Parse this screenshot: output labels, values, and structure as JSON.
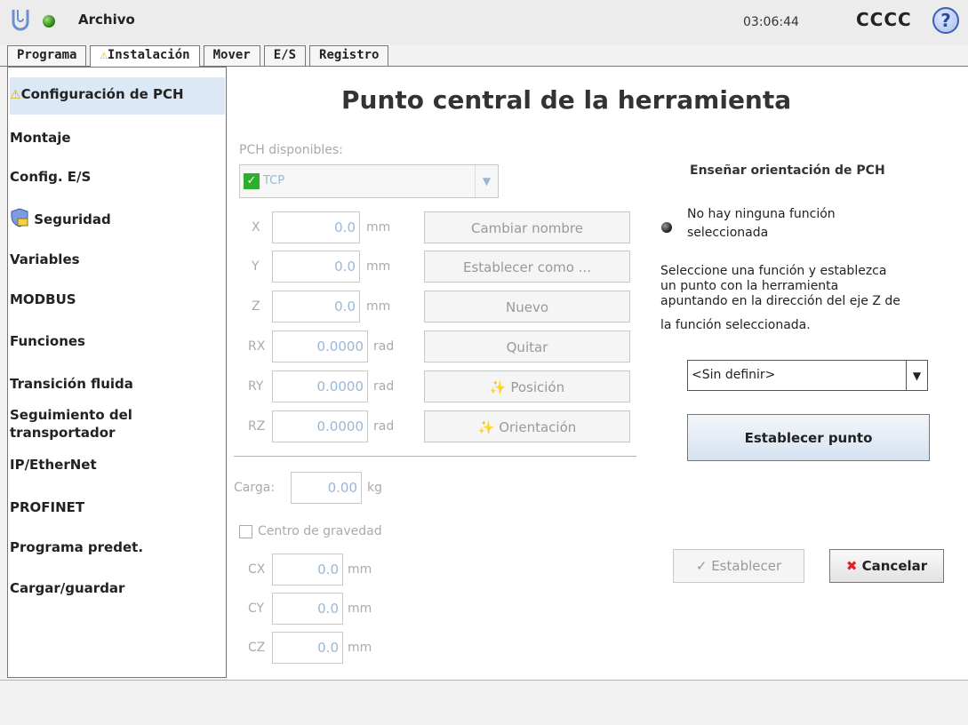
{
  "header": {
    "file_menu": "Archivo",
    "time": "03:06:44",
    "robot_name": "CCCC",
    "help_symbol": "?"
  },
  "tabs": [
    {
      "label": "Programa",
      "warning": false
    },
    {
      "label": "Instalación",
      "warning": true
    },
    {
      "label": "Mover",
      "warning": false
    },
    {
      "label": "E/S",
      "warning": false
    },
    {
      "label": "Registro",
      "warning": false
    }
  ],
  "sidebar": {
    "items": [
      {
        "label": "Configuración de PCH",
        "warning": true,
        "active": true
      },
      {
        "label": "Montaje"
      },
      {
        "label": "Config. E/S"
      },
      {
        "label": "Seguridad",
        "icon": "shield-icon"
      },
      {
        "label": "Variables"
      },
      {
        "label": "MODBUS"
      },
      {
        "label": "Funciones"
      },
      {
        "label": "Transición fluida"
      },
      {
        "label": "Seguimiento del transportador"
      },
      {
        "label": "IP/EtherNet"
      },
      {
        "label": "PROFINET"
      },
      {
        "label": "Programa predet."
      },
      {
        "label": "Cargar/guardar"
      }
    ]
  },
  "main": {
    "title": "Punto central de la herramienta",
    "available_label": "PCH disponibles:",
    "selected_tcp": "TCP",
    "fields": [
      {
        "label": "X",
        "value": "0.0",
        "unit": "mm"
      },
      {
        "label": "Y",
        "value": "0.0",
        "unit": "mm"
      },
      {
        "label": "Z",
        "value": "0.0",
        "unit": "mm"
      },
      {
        "label": "RX",
        "value": "0.0000",
        "unit": "rad"
      },
      {
        "label": "RY",
        "value": "0.0000",
        "unit": "rad"
      },
      {
        "label": "RZ",
        "value": "0.0000",
        "unit": "rad"
      }
    ],
    "buttons": {
      "rename": "Cambiar nombre",
      "set_as": "Establecer como ...",
      "new": "Nuevo",
      "remove": "Quitar",
      "position": "Posición",
      "orientation": "Orientación"
    },
    "payload": {
      "label": "Carga:",
      "value": "0.00",
      "unit": "kg"
    },
    "cog": {
      "checkbox_label": "Centro de gravedad",
      "fields": [
        {
          "label": "CX",
          "value": "0.0",
          "unit": "mm"
        },
        {
          "label": "CY",
          "value": "0.0",
          "unit": "mm"
        },
        {
          "label": "CZ",
          "value": "0.0",
          "unit": "mm"
        }
      ]
    }
  },
  "right_panel": {
    "title": "Enseñar orientación de PCH",
    "status_line1": "No hay ninguna función",
    "status_line2": "seleccionada",
    "instruction_lines": [
      "Seleccione una función y establezca",
      "un punto con la herramienta",
      "apuntando en la dirección del eje Z de",
      "la función seleccionada."
    ],
    "feature_select": "<Sin definir>",
    "set_point_button": "Establecer punto",
    "apply_button": "Establecer",
    "cancel_button": "Cancelar"
  }
}
